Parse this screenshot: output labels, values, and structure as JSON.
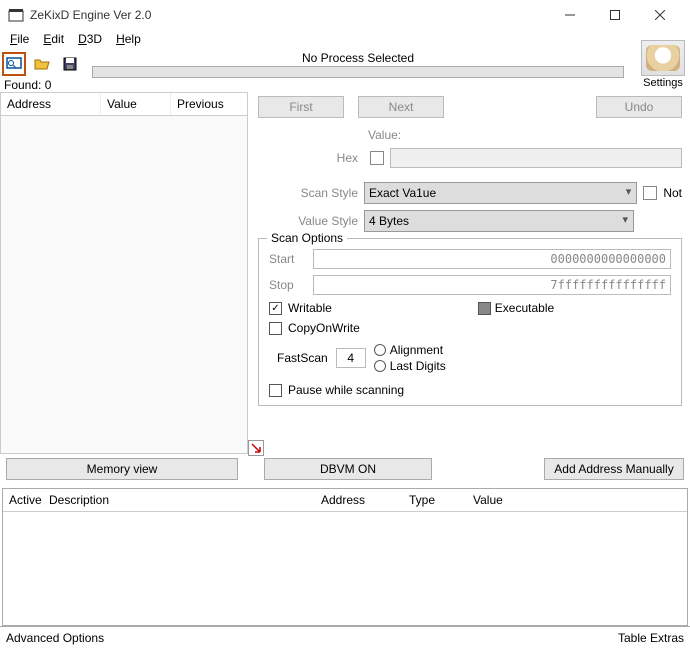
{
  "title": "ZeKixD Engine Ver 2.0",
  "menu": {
    "file": "File",
    "edit": "Edit",
    "d3d": "D3D",
    "help": "Help"
  },
  "toolbar": {
    "no_process": "No Process Selected",
    "settings": "Settings"
  },
  "found_label": "Found: 0",
  "leftcols": {
    "address": "Address",
    "value": "Value",
    "previous": "Previous"
  },
  "buttons": {
    "first": "First",
    "next": "Next",
    "undo": "Undo",
    "memview": "Memory view",
    "dbvm": "DBVM ON",
    "addmanual": "Add Address Manually"
  },
  "form": {
    "value_label": "Value:",
    "hex": "Hex",
    "scan_style": "Scan Style",
    "scan_style_val": "Exact Va1ue",
    "not": "Not",
    "value_style": "Value Style",
    "value_style_val": "4 Bytes"
  },
  "group": {
    "title": "Scan Options",
    "start": "Start",
    "start_val": "0000000000000000",
    "stop": "Stop",
    "stop_val": "7fffffffffffffff",
    "writable": "Writable",
    "executable": "Executable",
    "copyonwrite": "CopyOnWrite",
    "fastscan": "FastScan",
    "fastscan_val": "4",
    "alignment": "Alignment",
    "lastdigits": "Last Digits",
    "pause": "Pause while scanning"
  },
  "table": {
    "active": "Active",
    "description": "Description",
    "address": "Address",
    "type": "Type",
    "value": "Value"
  },
  "footer": {
    "adv": "Advanced Options",
    "extras": "Table Extras"
  }
}
